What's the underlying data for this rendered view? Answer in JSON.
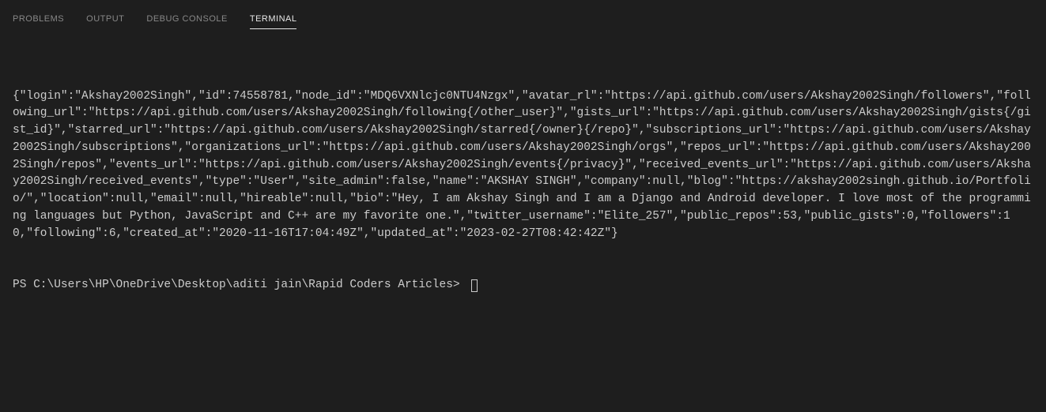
{
  "tabs": {
    "problems": "PROBLEMS",
    "output": "OUTPUT",
    "debug_console": "DEBUG CONSOLE",
    "terminal": "TERMINAL"
  },
  "terminal": {
    "output": "{\"login\":\"Akshay2002Singh\",\"id\":74558781,\"node_id\":\"MDQ6VXNlcjc0NTU4Nzgx\",\"avatar_rl\":\"https://api.github.com/users/Akshay2002Singh/followers\",\"following_url\":\"https://api.github.com/users/Akshay2002Singh/following{/other_user}\",\"gists_url\":\"https://api.github.com/users/Akshay2002Singh/gists{/gist_id}\",\"starred_url\":\"https://api.github.com/users/Akshay2002Singh/starred{/owner}{/repo}\",\"subscriptions_url\":\"https://api.github.com/users/Akshay2002Singh/subscriptions\",\"organizations_url\":\"https://api.github.com/users/Akshay2002Singh/orgs\",\"repos_url\":\"https://api.github.com/users/Akshay2002Singh/repos\",\"events_url\":\"https://api.github.com/users/Akshay2002Singh/events{/privacy}\",\"received_events_url\":\"https://api.github.com/users/Akshay2002Singh/received_events\",\"type\":\"User\",\"site_admin\":false,\"name\":\"AKSHAY SINGH\",\"company\":null,\"blog\":\"https://akshay2002singh.github.io/Portfolio/\",\"location\":null,\"email\":null,\"hireable\":null,\"bio\":\"Hey, I am Akshay Singh and I am a Django and Android developer. I love most of the programming languages but Python, JavaScript and C++ are my favorite one.\",\"twitter_username\":\"Elite_257\",\"public_repos\":53,\"public_gists\":0,\"followers\":10,\"following\":6,\"created_at\":\"2020-11-16T17:04:49Z\",\"updated_at\":\"2023-02-27T08:42:42Z\"}",
    "prompt": "PS C:\\Users\\HP\\OneDrive\\Desktop\\aditi jain\\Rapid Coders Articles> "
  }
}
